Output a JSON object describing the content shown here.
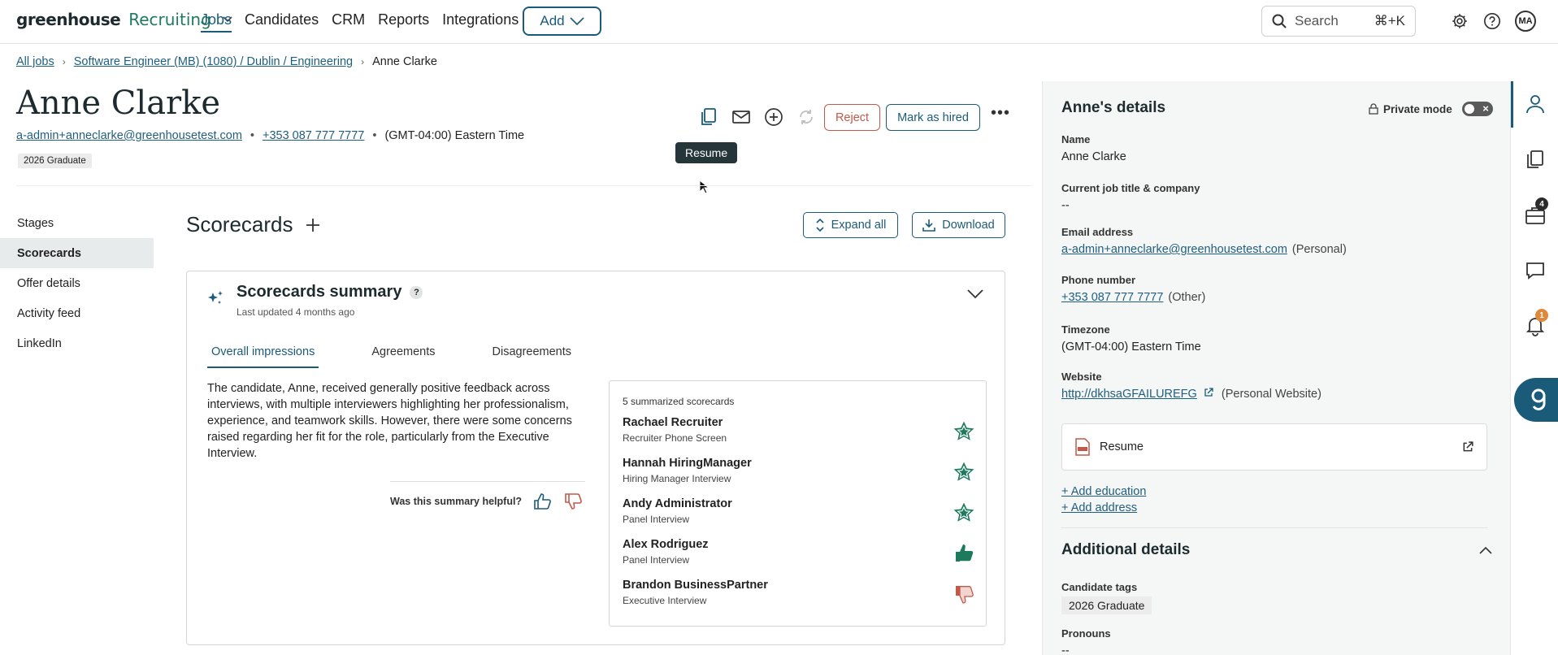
{
  "app": {
    "brand": "greenhouse",
    "product": "Recruiting",
    "nav": [
      "Jobs",
      "Candidates",
      "CRM",
      "Reports",
      "Integrations"
    ],
    "add_label": "Add",
    "search_placeholder": "Search",
    "search_shortcut": "⌘+K",
    "user_initials": "MA"
  },
  "breadcrumb": {
    "all_jobs": "All jobs",
    "job": "Software Engineer (MB) (1080) / Dublin / Engineering",
    "current": "Anne Clarke"
  },
  "candidate": {
    "name": "Anne Clarke",
    "email": "a-admin+anneclarke@greenhousetest.com",
    "phone": "+353 087 777 7777",
    "timezone": "(GMT-04:00) Eastern Time",
    "tag": "2026 Graduate"
  },
  "actions": {
    "reject": "Reject",
    "mark_hired": "Mark as hired",
    "tooltip": "Resume"
  },
  "subnav": [
    "Stages",
    "Scorecards",
    "Offer details",
    "Activity feed",
    "LinkedIn"
  ],
  "scorecards": {
    "title": "Scorecards",
    "expand_all": "Expand all",
    "download": "Download",
    "summary_title": "Scorecards summary",
    "help_glyph": "?",
    "last_updated": "Last updated 4 months ago",
    "tabs": [
      "Overall impressions",
      "Agreements",
      "Disagreements"
    ],
    "summary_text": "The candidate, Anne, received generally positive feedback across interviews, with multiple interviewers highlighting her professionalism, experience, and teamwork skills. However, there were some concerns raised regarding her fit for the role, particularly from the Executive Interview.",
    "helpful_q": "Was this summary helpful?",
    "count_label": "5 summarized scorecards",
    "items": [
      {
        "name": "Rachael Recruiter",
        "stage": "Recruiter Phone Screen",
        "rating": "strong-yes-icon"
      },
      {
        "name": "Hannah HiringManager",
        "stage": "Hiring Manager Interview",
        "rating": "strong-yes-icon"
      },
      {
        "name": "Andy Administrator",
        "stage": "Panel Interview",
        "rating": "strong-yes-icon"
      },
      {
        "name": "Alex Rodriguez",
        "stage": "Panel Interview",
        "rating": "yes-icon"
      },
      {
        "name": "Brandon BusinessPartner",
        "stage": "Executive Interview",
        "rating": "no-icon"
      }
    ]
  },
  "details": {
    "title": "Anne's details",
    "private_mode": "Private mode",
    "name_label": "Name",
    "name_value": "Anne Clarke",
    "job_label": "Current job title & company",
    "job_value": "--",
    "email_label": "Email address",
    "email_value": "a-admin+anneclarke@greenhousetest.com",
    "email_type": "(Personal)",
    "phone_label": "Phone number",
    "phone_value": "+353 087 777 7777",
    "phone_type": "(Other)",
    "tz_label": "Timezone",
    "tz_value": "(GMT-04:00) Eastern Time",
    "web_label": "Website",
    "web_value": "http://dkhsaGFAILUREFG",
    "web_type": "(Personal Website)",
    "resume": "Resume",
    "add_education": "+ Add education",
    "add_address": "+ Add address",
    "additional_title": "Additional details",
    "tags_label": "Candidate tags",
    "tags_value": "2026 Graduate",
    "pronouns_label": "Pronouns",
    "pronouns_value": "--"
  },
  "rail": {
    "jobs_badge": "4",
    "alerts_badge": "1"
  },
  "colors": {
    "primary": "#1a5b7a",
    "reject": "#c2584a",
    "star": "#1e7a5d",
    "thumb_down": "#c2584a"
  }
}
